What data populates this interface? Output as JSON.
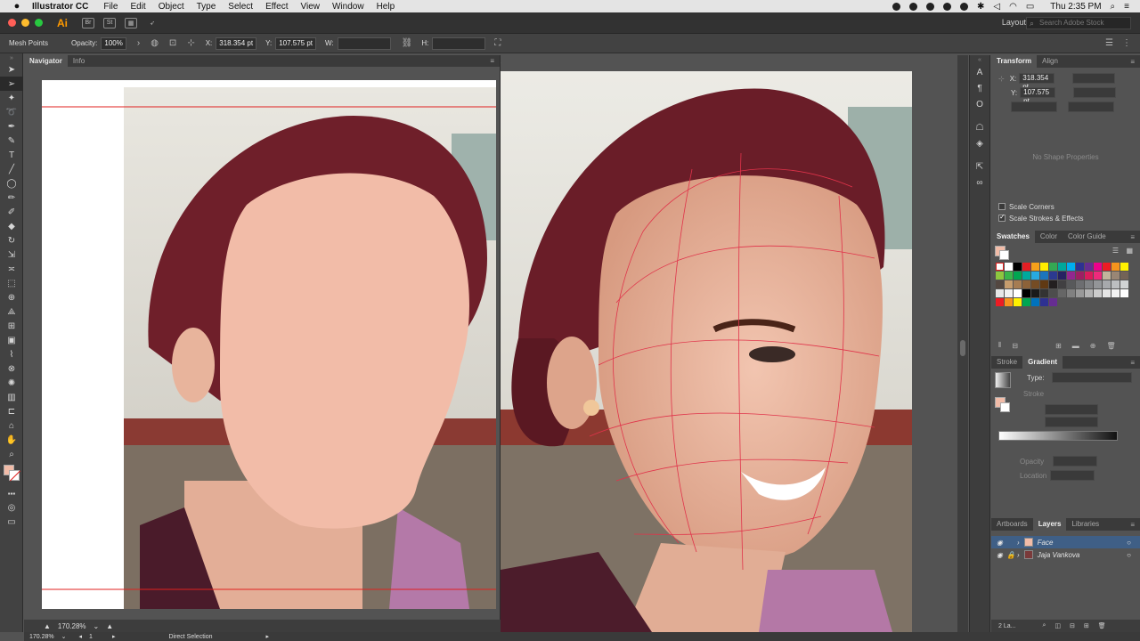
{
  "menubar": {
    "app": "Illustrator CC",
    "items": [
      "File",
      "Edit",
      "Object",
      "Type",
      "Select",
      "Effect",
      "View",
      "Window",
      "Help"
    ],
    "clock": "Thu 2:35 PM"
  },
  "appbar": {
    "logo": "Ai",
    "br": "Br",
    "st": "St",
    "workspace": "Layout",
    "search_placeholder": "Search Adobe Stock"
  },
  "controlbar": {
    "mode": "Mesh Points",
    "opacity_label": "Opacity:",
    "opacity_value": "100%",
    "x_label": "X:",
    "x_value": "318.354 pt",
    "y_label": "Y:",
    "y_value": "107.575 pt",
    "w_label": "W:",
    "h_label": "H:"
  },
  "navigator": {
    "tabs": [
      "Navigator",
      "Info"
    ],
    "zoom": "170.28%"
  },
  "transform": {
    "tabs": [
      "Transform",
      "Align"
    ],
    "x_value": "318.354 pt",
    "y_value": "107.575 pt",
    "x_label": "X:",
    "y_label": "Y:",
    "no_shape": "No Shape Properties",
    "scale_corners": "Scale Corners",
    "scale_strokes": "Scale Strokes & Effects"
  },
  "swatches": {
    "tabs": [
      "Swatches",
      "Color",
      "Color Guide"
    ],
    "colors": [
      "#ffffff",
      "#ffffff",
      "#000000",
      "#e31e24",
      "#f6a01a",
      "#ffed00",
      "#34a853",
      "#00a89c",
      "#00aeef",
      "#2e3192",
      "#662d91",
      "#ec008c",
      "#ed1c24",
      "#f7941d",
      "#fff200",
      "#8dc63f",
      "#39b54a",
      "#00a651",
      "#00a99d",
      "#27aae1",
      "#1c75bc",
      "#2b3990",
      "#262262",
      "#92278f",
      "#9e1f63",
      "#da1c5c",
      "#ee2a7b",
      "#c2b59b",
      "#998675",
      "#736357",
      "#534741",
      "#c69c6d",
      "#a67c52",
      "#8c6239",
      "#754c24",
      "#603913",
      "#231f20",
      "#414042",
      "#58595b",
      "#6d6e71",
      "#808285",
      "#939598",
      "#a7a9ac",
      "#bcbec0",
      "#d1d3d4",
      "#e6e7e8",
      "#f1f2f2",
      "#ffffff",
      "#000000",
      "#1a1a1a",
      "#333333",
      "#4d4d4d",
      "#666666",
      "#808080",
      "#999999",
      "#b3b3b3",
      "#cccccc",
      "#e6e6e6",
      "#f2f2f2",
      "#ffffff",
      "#ed1c24",
      "#f7941d",
      "#fff200",
      "#00a651",
      "#0072bc",
      "#2e3192",
      "#662d91"
    ]
  },
  "gradient": {
    "tabs": [
      "Stroke",
      "Gradient"
    ],
    "type_label": "Type:",
    "stroke_label": "Stroke",
    "opacity_label": "Opacity",
    "location_label": "Location"
  },
  "layers": {
    "tabs": [
      "Artboards",
      "Layers",
      "Libraries"
    ],
    "items": [
      {
        "name": "Face"
      },
      {
        "name": "Jaja Vankova"
      }
    ],
    "count": "2 La..."
  },
  "statusbar": {
    "zoom": "170.28%",
    "artboard": "1",
    "tool": "Direct Selection"
  }
}
